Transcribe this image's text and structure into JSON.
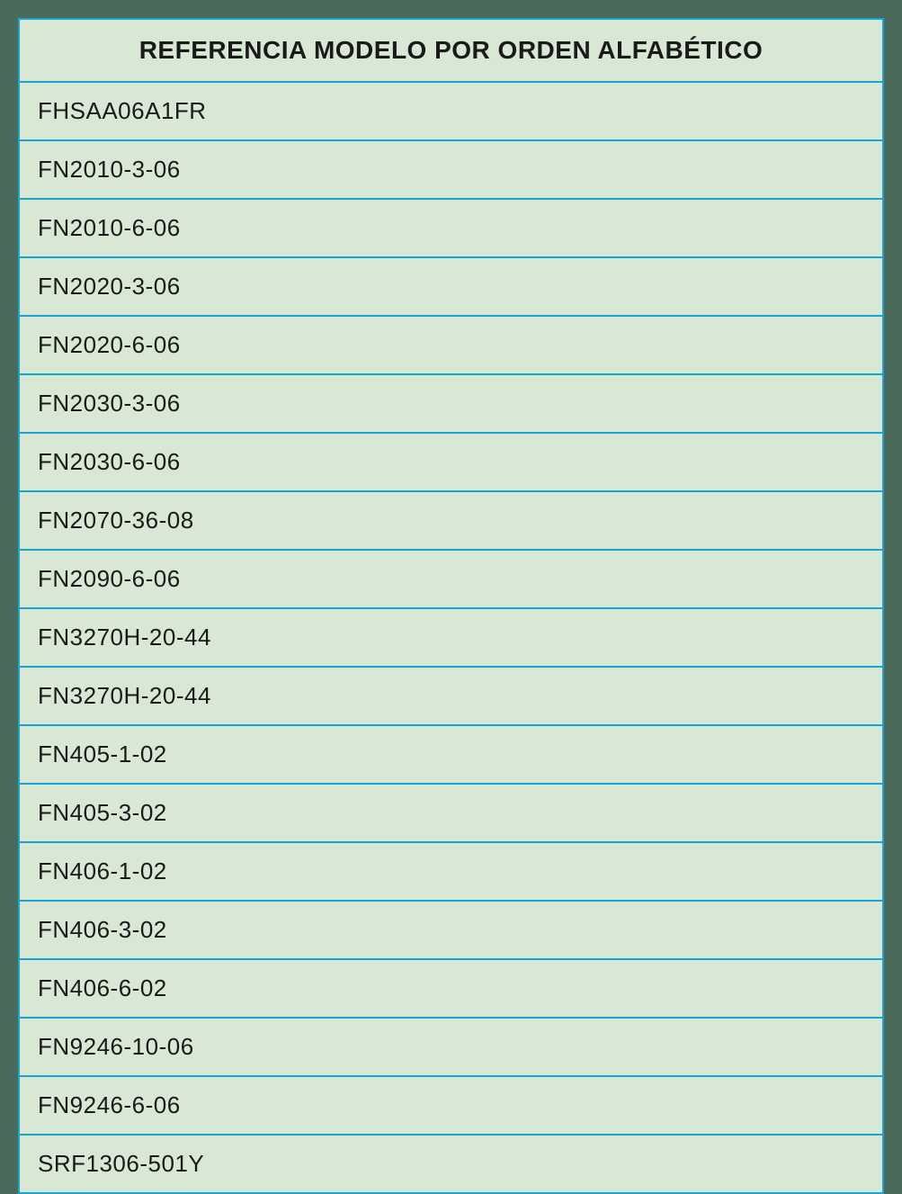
{
  "table": {
    "header": "REFERENCIA MODELO POR ORDEN ALFABÉTICO",
    "rows": [
      "FHSAA06A1FR",
      "FN2010-3-06",
      "FN2010-6-06",
      "FN2020-3-06",
      "FN2020-6-06",
      "FN2030-3-06",
      "FN2030-6-06",
      "FN2070-36-08",
      "FN2090-6-06",
      "FN3270H-20-44",
      "FN3270H-20-44",
      "FN405-1-02",
      "FN405-3-02",
      "FN406-1-02",
      "FN406-3-02",
      "FN406-6-02",
      "FN9246-10-06",
      "FN9246-6-06",
      "SRF1306-501Y"
    ]
  }
}
